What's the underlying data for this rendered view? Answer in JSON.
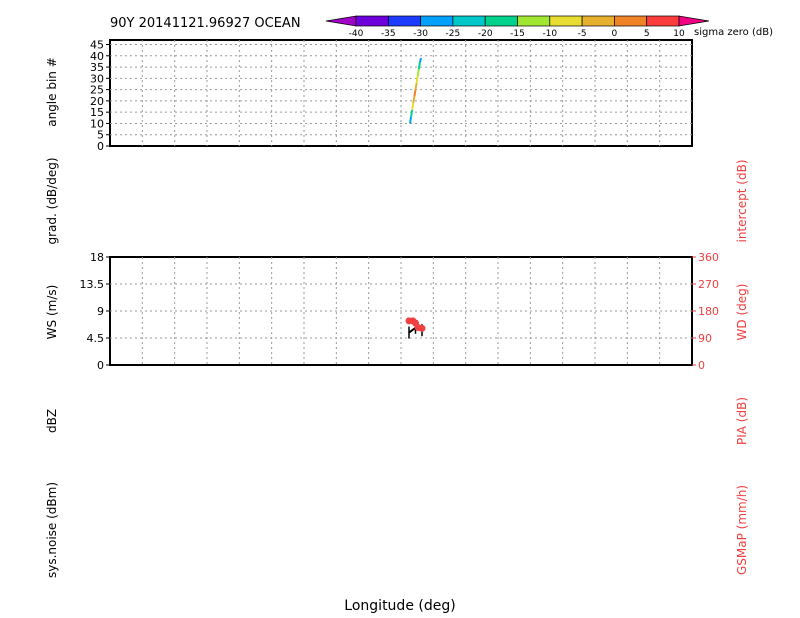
{
  "header": {
    "title": "90Y 20141121.96927 OCEAN"
  },
  "colorbar": {
    "label": "sigma zero (dB)",
    "ticks": [
      "-40",
      "-35",
      "-30",
      "-25",
      "-20",
      "-15",
      "-10",
      "-5",
      "0",
      "5",
      "10"
    ],
    "colors": [
      "#a000c8",
      "#6e00dc",
      "#1e3cff",
      "#00a0ff",
      "#00c8c8",
      "#00d28c",
      "#a0e632",
      "#e6dc32",
      "#e6af2d",
      "#f08228",
      "#fa3c3c",
      "#f00082"
    ]
  },
  "x_axis": {
    "label": "Longitude (deg)"
  },
  "panels": {
    "angle": {
      "ylabel": "angle bin #"
    },
    "grad": {
      "ylabel_left": "grad. (dB/deg)",
      "ylabel_right": "intercept (dB)"
    },
    "wind": {
      "ylabel_left": "WS (m/s)",
      "ylabel_right": "WD (deg)"
    },
    "dbz": {
      "ylabel_left": "dBZ",
      "ylabel_right": "PIA (dB)"
    },
    "noise": {
      "ylabel_left": "sys.noise (dBm)",
      "ylabel_right": "GSMaP (mm/h)"
    }
  },
  "colors": {
    "axis": "#000000",
    "grid": "#9a9a9a",
    "right_axis": "#f04040",
    "wind_dir_marker": "#f04040"
  },
  "chart_data": [
    {
      "type": "line",
      "name": "angle-bin",
      "ylabel": "angle bin #",
      "ylim": [
        0,
        47
      ],
      "yticks": [
        0,
        5,
        10,
        15,
        20,
        25,
        30,
        35,
        40,
        45
      ],
      "series": [
        {
          "x": [
            0.0,
            0.1,
            0.2,
            0.3,
            0.4,
            0.5,
            0.6,
            0.7,
            0.8,
            0.9,
            1.0
          ],
          "y": [
            10,
            13,
            16,
            19,
            22,
            25,
            28,
            31,
            34,
            37,
            39
          ],
          "sigma0_db": [
            -30,
            -20,
            -10,
            -5,
            0,
            -5,
            -10,
            -15,
            -20,
            -28,
            -32
          ]
        }
      ],
      "grid": true
    },
    {
      "type": "scatter",
      "name": "wind",
      "ylabel": "WS (m/s)",
      "ylim": [
        0,
        18
      ],
      "yticks": [
        "0",
        "4.5",
        "9",
        "13.5",
        "18"
      ],
      "y2label": "WD (deg)",
      "y2lim": [
        0,
        360
      ],
      "y2ticks": [
        "0",
        "90",
        "180",
        "270",
        "360"
      ],
      "series": [
        {
          "x": [
            0.0,
            0.5,
            1.0
          ],
          "y": [
            5.4,
            6.2,
            5.8
          ]
        },
        {
          "x": [
            0.0,
            0.3,
            0.5,
            0.7,
            1.0
          ],
          "y2": [
            147,
            147,
            140,
            125,
            122
          ]
        }
      ],
      "grid": true
    }
  ]
}
